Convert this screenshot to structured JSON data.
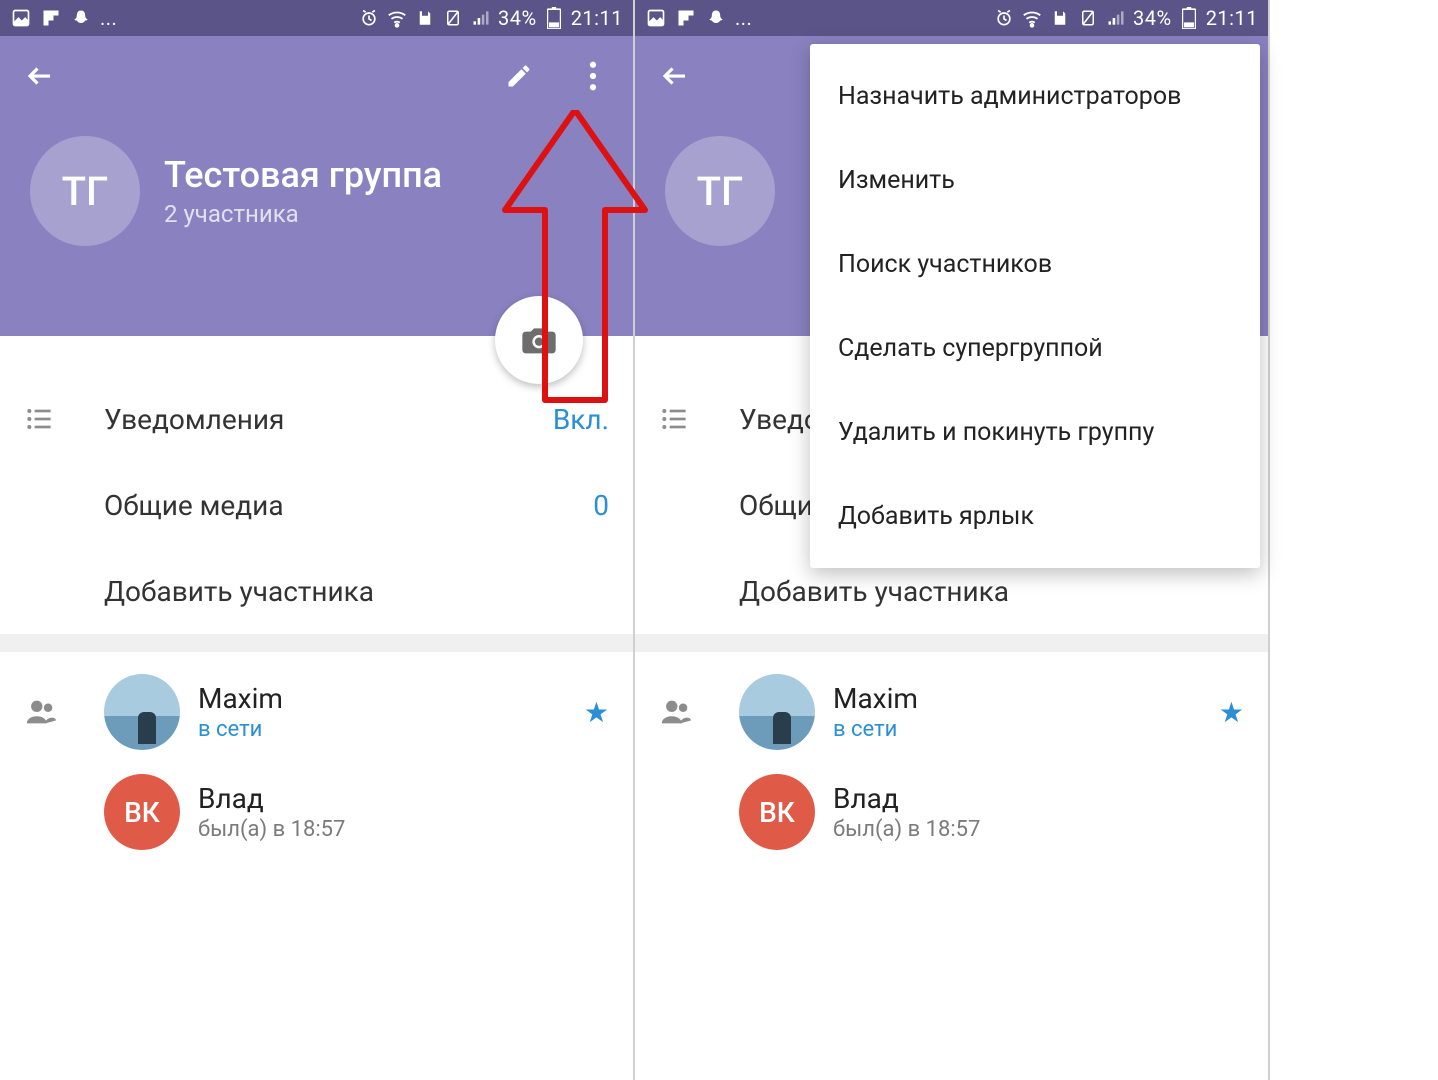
{
  "statusbar": {
    "battery_pct": "34%",
    "time": "21:11",
    "ellipsis": "..."
  },
  "group": {
    "avatar_initials": "ТГ",
    "title": "Тестовая группа",
    "subtitle": "2 участника"
  },
  "rows": {
    "notifications_label": "Уведомления",
    "notifications_value": "Вкл.",
    "shared_media_label": "Общие медиа",
    "shared_media_value": "0",
    "add_member_label": "Добавить участника"
  },
  "members": [
    {
      "name": "Maxim",
      "status": "в сети",
      "online": true,
      "avatar_type": "photo",
      "initials": "",
      "star": true
    },
    {
      "name": "Влад",
      "status": "был(а) в 18:57",
      "online": false,
      "avatar_type": "red",
      "initials": "ВК",
      "star": false
    }
  ],
  "popup_items": [
    "Назначить администраторов",
    "Изменить",
    "Поиск участников",
    "Сделать супергруппой",
    "Удалить и покинуть группу",
    "Добавить ярлык"
  ],
  "colors": {
    "accent": "#2a8fd4",
    "header": "#8a82c0",
    "status": "#5a5489"
  }
}
